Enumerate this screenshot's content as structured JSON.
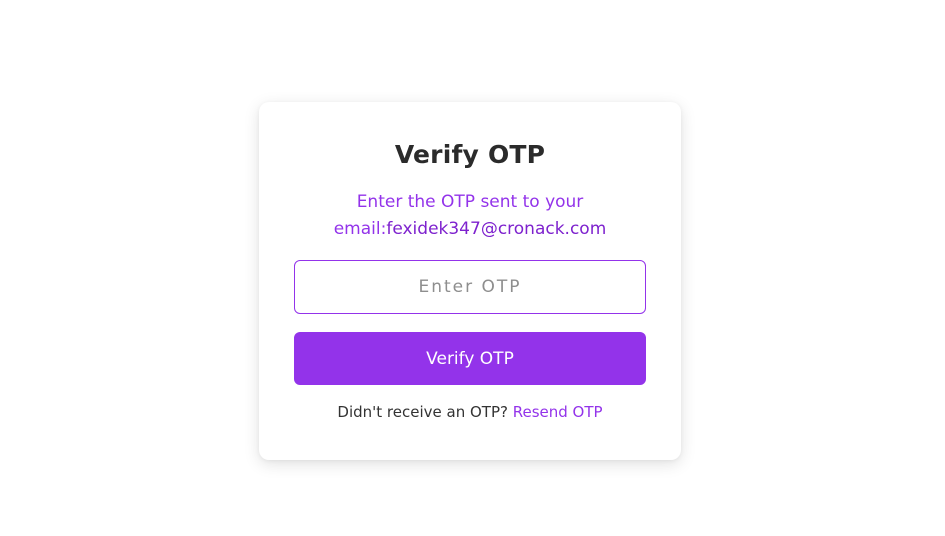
{
  "card": {
    "title": "Verify OTP",
    "subtitle_line1": "Enter the OTP sent to your",
    "subtitle_prefix": "email:",
    "email": "fexidek347@cronack.com"
  },
  "otp_input": {
    "placeholder": "Enter OTP",
    "value": ""
  },
  "verify_button": {
    "label": "Verify OTP"
  },
  "resend": {
    "prompt": "Didn't receive an OTP?",
    "link_label": "Resend OTP"
  },
  "colors": {
    "accent": "#9333ea",
    "title": "#2b2b2b",
    "background": "#ffffff"
  }
}
